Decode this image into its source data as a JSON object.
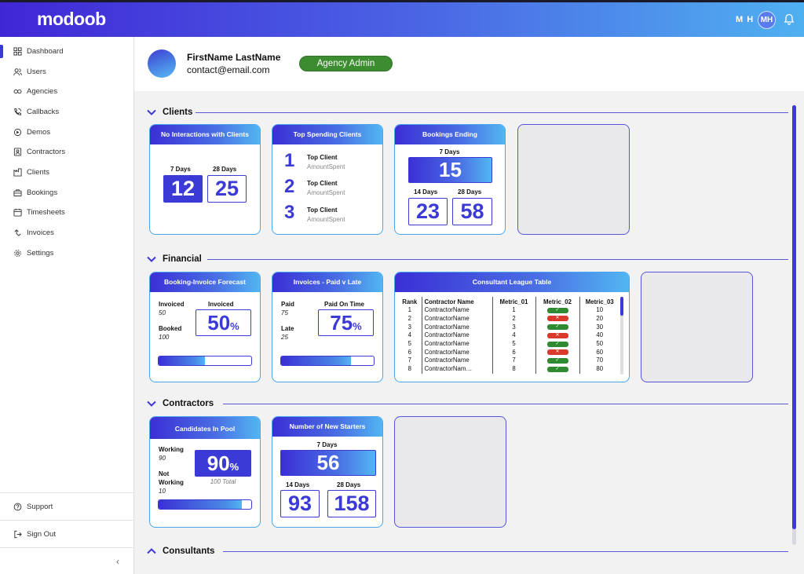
{
  "app": {
    "logo": "modoob"
  },
  "topbar": {
    "user_initials": "M H",
    "avatar_initials": "MH"
  },
  "sidebar": {
    "items": [
      {
        "label": "Dashboard",
        "icon": "dashboard-icon"
      },
      {
        "label": "Users",
        "icon": "users-icon"
      },
      {
        "label": "Agencies",
        "icon": "agencies-icon"
      },
      {
        "label": "Callbacks",
        "icon": "phone-icon"
      },
      {
        "label": "Demos",
        "icon": "demos-icon"
      },
      {
        "label": "Contractors",
        "icon": "contractors-icon"
      },
      {
        "label": "Clients",
        "icon": "clients-icon"
      },
      {
        "label": "Bookings",
        "icon": "bookings-icon"
      },
      {
        "label": "Timesheets",
        "icon": "timesheets-icon"
      },
      {
        "label": "Invoices",
        "icon": "invoices-icon"
      },
      {
        "label": "Settings",
        "icon": "settings-icon"
      }
    ],
    "support": "Support",
    "signout": "Sign Out",
    "collapse": "‹"
  },
  "profile": {
    "name": "FirstName LastName",
    "email": "contact@email.com",
    "role": "Agency Admin"
  },
  "sections": {
    "clients": "Clients",
    "financial": "Financial",
    "contractors": "Contractors",
    "consultants": "Consultants"
  },
  "cards": {
    "no_interactions": {
      "title": "No Interactions with Clients",
      "label_7": "7 Days",
      "value_7": "12",
      "label_28": "28 Days",
      "value_28": "25"
    },
    "top_spending": {
      "title": "Top Spending Clients",
      "items": [
        {
          "rank": "1",
          "name": "Top Client",
          "amount": "AmountSpent"
        },
        {
          "rank": "2",
          "name": "Top Client",
          "amount": "AmountSpent"
        },
        {
          "rank": "3",
          "name": "Top Client",
          "amount": "AmountSpent"
        }
      ]
    },
    "bookings_ending": {
      "title": "Bookings Ending",
      "label_7": "7 Days",
      "value_7": "15",
      "label_14": "14 Days",
      "value_14": "23",
      "label_28": "28 Days",
      "value_28": "58"
    },
    "forecast": {
      "title": "Booking-Invoice Forecast",
      "invoiced_label": "Invoiced",
      "invoiced_value": "50",
      "booked_label": "Booked",
      "booked_value": "100",
      "pct_label": "Invoiced",
      "pct": "50",
      "pct_sign": "%",
      "progress": 0.5
    },
    "paid_late": {
      "title": "Invoices - Paid v Late",
      "paid_label": "Paid",
      "paid_value": "75",
      "late_label": "Late",
      "late_value": "25",
      "pct_label": "Paid On Time",
      "pct": "75",
      "pct_sign": "%",
      "progress": 0.75
    },
    "league": {
      "title": "Consultant League Table",
      "headers": [
        "Rank",
        "Contractor Name",
        "Metric_01",
        "Metric_02",
        "Metric_03"
      ],
      "rows": [
        {
          "rank": "1",
          "name": "ContractorName",
          "m1": "1",
          "m2": "ok",
          "m3": "10"
        },
        {
          "rank": "2",
          "name": "ContractorName",
          "m1": "2",
          "m2": "no",
          "m3": "20"
        },
        {
          "rank": "3",
          "name": "ContractorName",
          "m1": "3",
          "m2": "ok",
          "m3": "30"
        },
        {
          "rank": "4",
          "name": "ContractorName",
          "m1": "4",
          "m2": "no",
          "m3": "40"
        },
        {
          "rank": "5",
          "name": "ContractorName",
          "m1": "5",
          "m2": "ok",
          "m3": "50"
        },
        {
          "rank": "6",
          "name": "ContractorName",
          "m1": "6",
          "m2": "no",
          "m3": "60"
        },
        {
          "rank": "7",
          "name": "ContractorName",
          "m1": "7",
          "m2": "ok",
          "m3": "70"
        },
        {
          "rank": "8",
          "name": "ContractorNam…",
          "m1": "8",
          "m2": "ok",
          "m3": "80"
        }
      ],
      "ok_mark": "✓",
      "no_mark": "✕"
    },
    "candidates": {
      "title": "Candidates In Pool",
      "working_label": "Working",
      "working_value": "90",
      "not_working_label_1": "Not",
      "not_working_label_2": "Working",
      "not_working_value": "10",
      "pct": "90",
      "pct_sign": "%",
      "total": "100 Total",
      "progress": 0.9
    },
    "new_starters": {
      "title": "Number of New Starters",
      "label_7": "7 Days",
      "value_7": "56",
      "label_14": "14 Days",
      "value_14": "93",
      "label_28": "28 Days",
      "value_28": "158"
    }
  },
  "colors": {
    "accent": "#3b3ad6",
    "badge_green": "#3b8d2f",
    "ok_green": "#2f8a31",
    "error_red": "#d93a2b",
    "gradient_start": "#3b2fd5",
    "gradient_end": "#52b6f2"
  }
}
